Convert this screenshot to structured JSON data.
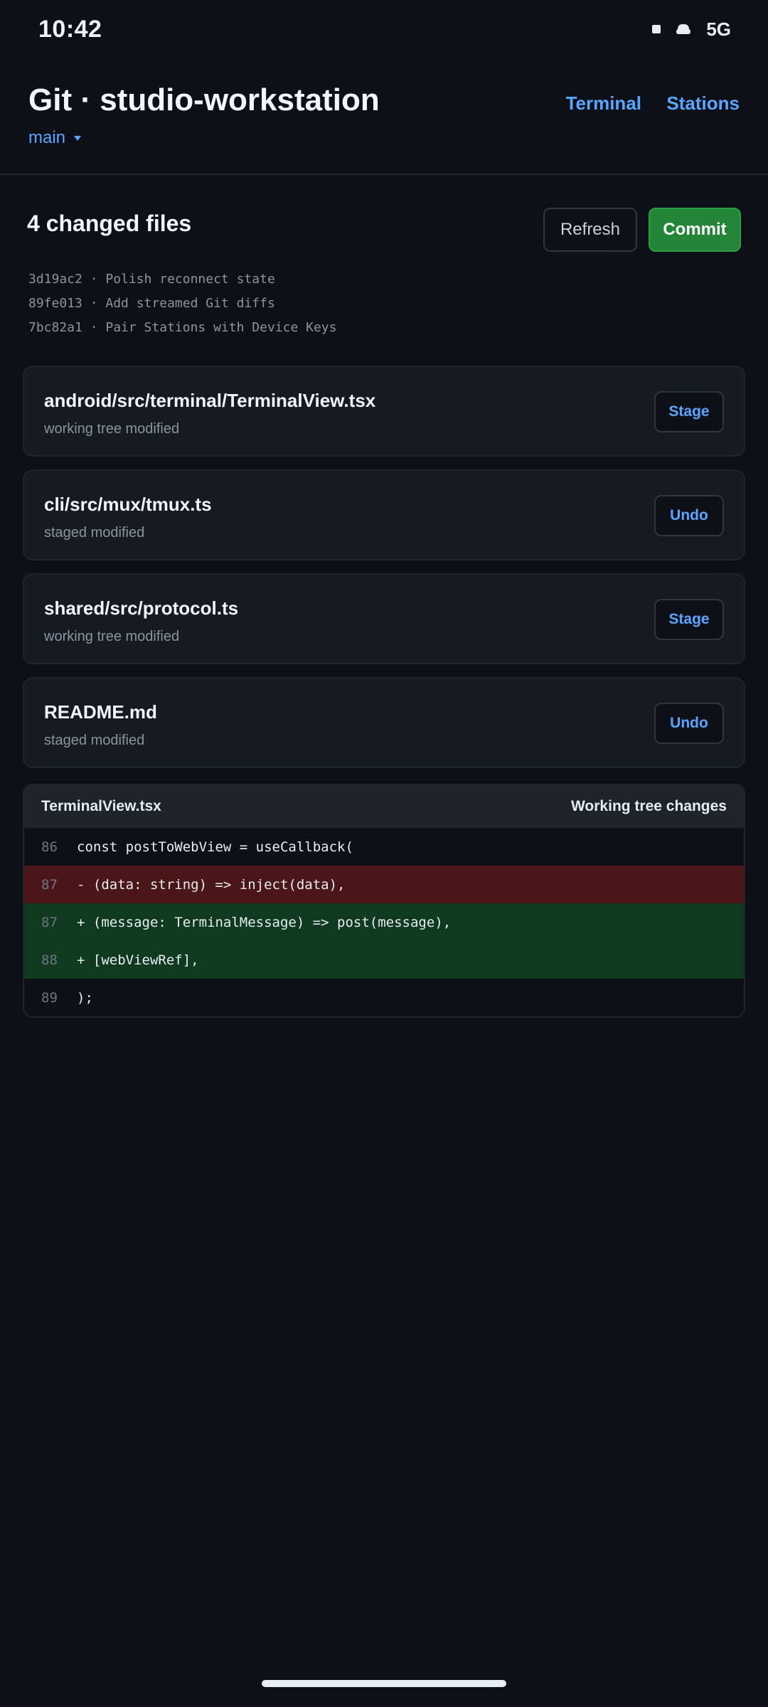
{
  "status_bar": {
    "time": "10:42",
    "network": "5G",
    "icons": [
      "notification-square-icon",
      "car-icon"
    ]
  },
  "header": {
    "title": "Git · studio-workstation",
    "branch": "main",
    "nav": {
      "terminal": "Terminal",
      "stations": "Stations"
    }
  },
  "changes": {
    "count_label": "4 changed files",
    "refresh_label": "Refresh",
    "commit_label": "Commit"
  },
  "commits": [
    "3d19ac2 · Polish reconnect state",
    "89fe013 · Add streamed Git diffs",
    "7bc82a1 · Pair Stations with Device Keys"
  ],
  "files": [
    {
      "path": "android/src/terminal/TerminalView.tsx",
      "state": "working tree modified",
      "action": "Stage"
    },
    {
      "path": "cli/src/mux/tmux.ts",
      "state": "staged modified",
      "action": "Undo"
    },
    {
      "path": "shared/src/protocol.ts",
      "state": "working tree modified",
      "action": "Stage"
    },
    {
      "path": "README.md",
      "state": "staged modified",
      "action": "Undo"
    }
  ],
  "diff": {
    "file": "TerminalView.tsx",
    "mode": "Working tree changes",
    "lines": [
      {
        "num": "86",
        "type": "ctx",
        "code": "const postToWebView = useCallback("
      },
      {
        "num": "87",
        "type": "del",
        "code": "- (data: string) => inject(data),"
      },
      {
        "num": "87",
        "type": "add",
        "code": "+ (message: TerminalMessage) => post(message),"
      },
      {
        "num": "88",
        "type": "add",
        "code": "+ [webViewRef],"
      },
      {
        "num": "89",
        "type": "ctx",
        "code": ");"
      }
    ]
  },
  "colors": {
    "background": "#0d1117",
    "accent": "#58a6ff",
    "commit_button": "#238636",
    "diff_added": "#0f3a1f",
    "diff_removed": "#4a1618"
  }
}
